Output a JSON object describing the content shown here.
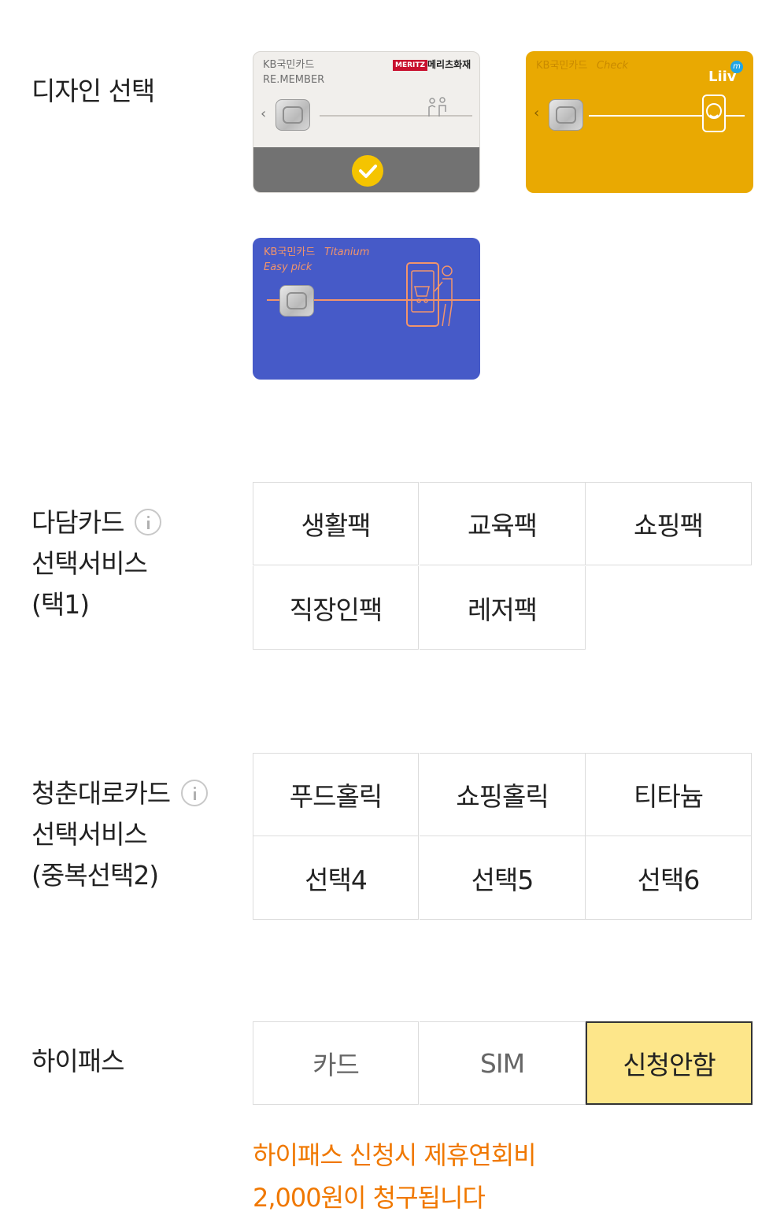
{
  "design": {
    "label": "디자인 선택",
    "cards": [
      {
        "brand": "KB국민카드",
        "line2": "RE.MEMBER",
        "partner_badge": "MERITZ",
        "partner": "메리츠화재",
        "selected": true,
        "color": "#f1efec"
      },
      {
        "brand": "KB국민카드",
        "line2": "Check",
        "partner": "Liiv",
        "selected": false,
        "color": "#e9a902"
      },
      {
        "brand": "KB국민카드",
        "line2": "Titanium",
        "line3": "Easy pick",
        "selected": false,
        "color": "#465ac8"
      }
    ]
  },
  "dadam": {
    "label_line1": "다담카드",
    "label_line2": "선택서비스",
    "label_line3": "(택1)",
    "options": [
      "생활팩",
      "교육팩",
      "쇼핑팩",
      "직장인팩",
      "레저팩"
    ]
  },
  "youth": {
    "label_line1": "청춘대로카드",
    "label_line2": "선택서비스",
    "label_line3": "(중복선택2)",
    "options": [
      "푸드홀릭",
      "쇼핑홀릭",
      "티타늄",
      "선택4",
      "선택5",
      "선택6"
    ]
  },
  "hipass": {
    "label": "하이패스",
    "options": [
      "카드",
      "SIM",
      "신청안함"
    ],
    "selected": "신청안함",
    "notice_line1": "하이패스 신청시 제휴연회비",
    "notice_line2": "2,000원이 청구됩니다"
  },
  "colors": {
    "selected_bg": "#fde68a",
    "notice": "#f07800",
    "check": "#f5c400"
  }
}
